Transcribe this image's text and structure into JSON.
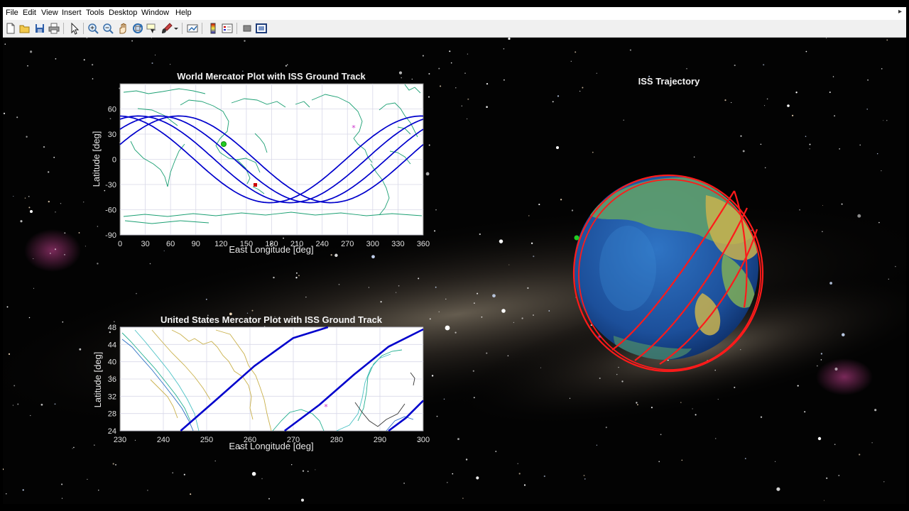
{
  "menu": [
    "File",
    "Edit",
    "View",
    "Insert",
    "Tools",
    "Desktop",
    "Window",
    "Help"
  ],
  "menu_corner_glyph": "▸",
  "toolbar": {
    "icons": [
      "new-figure-icon",
      "open-file-icon",
      "save-icon",
      "print-icon",
      "select-arrow-icon",
      "zoom-in-icon",
      "zoom-out-icon",
      "pan-icon",
      "rotate-3d-icon",
      "data-cursor-icon",
      "brush-icon",
      "brush-dropdown-icon",
      "link-plot-icon",
      "colorbar-icon",
      "legend-icon",
      "hide-plot-tools-icon",
      "show-plot-tools-icon"
    ]
  },
  "world_plot": {
    "title": "World Mercator Plot with ISS Ground Track",
    "xlabel": "East Longitude [deg]",
    "ylabel": "Latitude [deg]",
    "xticks": [
      "0",
      "30",
      "60",
      "90",
      "120",
      "150",
      "180",
      "210",
      "240",
      "270",
      "300",
      "330",
      "360"
    ],
    "yticks": [
      "60",
      "30",
      "0",
      "-30",
      "-60",
      "-90"
    ]
  },
  "us_plot": {
    "title": "United States Mercator Plot with ISS Ground Track",
    "xlabel": "East Longitude [deg]",
    "ylabel": "Latitude [deg]",
    "xticks": [
      "230",
      "240",
      "250",
      "260",
      "270",
      "280",
      "290",
      "300"
    ],
    "yticks": [
      "48",
      "44",
      "40",
      "36",
      "32",
      "28",
      "24"
    ]
  },
  "trajectory": {
    "title": "ISS Trajectory"
  },
  "chart_data": [
    {
      "type": "line",
      "title": "World Mercator Plot with ISS Ground Track",
      "xlabel": "East Longitude [deg]",
      "ylabel": "Latitude [deg]",
      "xlim": [
        0,
        360
      ],
      "ylim": [
        -90,
        90
      ],
      "grid": true,
      "orbit_inclination_deg": 51.6,
      "series": [
        {
          "type": "sinusoid",
          "descending_node_lon": [
            88,
            112,
            136,
            160
          ]
        }
      ],
      "markers": [
        {
          "kind": "start",
          "color": "#22cc22",
          "lon": 122,
          "lat": 10
        },
        {
          "kind": "current",
          "color": "#cc0000",
          "lon": 162,
          "lat": -40
        },
        {
          "kind": "ground-station",
          "color": "#cc33cc",
          "lon": 278,
          "lat": 30
        }
      ]
    },
    {
      "type": "line",
      "title": "United States Mercator Plot with ISS Ground Track",
      "xlabel": "East Longitude [deg]",
      "ylabel": "Latitude [deg]",
      "xlim": [
        230,
        300
      ],
      "ylim": [
        24,
        48
      ],
      "grid": true,
      "series": [
        {
          "points": [
            [
              244,
              24
            ],
            [
              252,
              31
            ],
            [
              261,
              39
            ],
            [
              270,
              45.5
            ],
            [
              278,
              48
            ]
          ]
        },
        {
          "points": [
            [
              268,
              24
            ],
            [
              276,
              30
            ],
            [
              284,
              37
            ],
            [
              292,
              43.5
            ],
            [
              300,
              47.5
            ]
          ]
        },
        {
          "points": [
            [
              292,
              24
            ],
            [
              296,
              27
            ],
            [
              300,
              31
            ]
          ]
        }
      ],
      "markers": [
        {
          "kind": "ground-station",
          "color": "#cc33cc",
          "lon": 278,
          "lat": 30
        }
      ]
    }
  ],
  "colors": {
    "track": "#0000cc",
    "orbit": "#ff1a1a",
    "coast": "#1a9f72",
    "grid": "#d8d8e8"
  }
}
